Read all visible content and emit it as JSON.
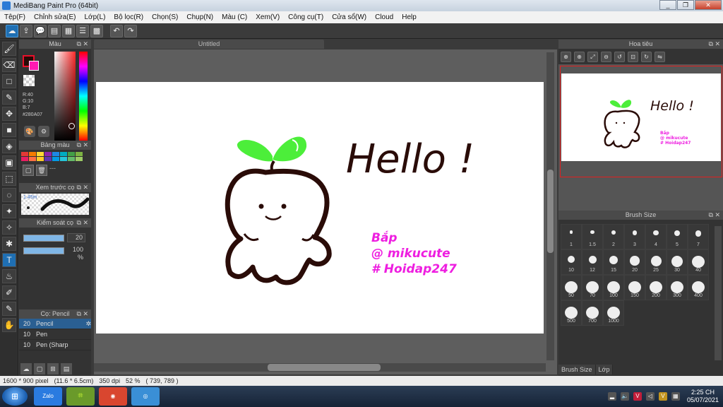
{
  "window": {
    "title": "MediBang Paint Pro (64bit)",
    "minimize": "_",
    "restore": "❐",
    "close": "✕"
  },
  "menu": [
    "Tệp(F)",
    "Chỉnh sửa(E)",
    "Lớp(L)",
    "Bộ lọc(R)",
    "Chọn(S)",
    "Chụp(N)",
    "Màu (C)",
    "Xem(V)",
    "Công cụ(T)",
    "Cửa sổ(W)",
    "Cloud",
    "Help"
  ],
  "toolbar": {
    "icons": [
      "cloud-icon",
      "share-icon",
      "chat-icon",
      "document-icon",
      "layers-icon",
      "list-icon",
      "grid-icon"
    ],
    "undo": "↶",
    "redo": "↷"
  },
  "tools": [
    "🖌",
    "⌫",
    "□",
    "✎",
    "✥",
    "■",
    "◈",
    "▣",
    "⬚",
    "◌",
    "✦",
    "✧",
    "✱",
    "T",
    "♨",
    "✐",
    "✎",
    "✋"
  ],
  "color_panel": {
    "title": "Màu",
    "r": "R:40",
    "g": "G:10",
    "b": "B:7",
    "hex": "#280A07",
    "fg": "#280A07",
    "bg": "#ff1ab2"
  },
  "palette_panel": {
    "title": "Bảng màu",
    "colors": [
      "#e53935",
      "#f57c00",
      "#fdd835",
      "#8e24aa",
      "#1e88e5",
      "#00acc1",
      "#43a047",
      "#7cb342",
      "#e91e63",
      "#ff7043",
      "#ffca28",
      "#5e35b1",
      "#039be5",
      "#26c6da",
      "#66bb6a",
      "#9ccc65"
    ],
    "dash": "---"
  },
  "preview_panel": {
    "title": "Xem trước cọ",
    "size": "1.45m"
  },
  "control_panel": {
    "title": "Kiểm soát cọ",
    "size_value": "20",
    "size_fraction": 1.0,
    "opacity_value": "100 %",
    "opacity_fraction": 1.0
  },
  "brush_panel": {
    "title": "Cọ: Pencil",
    "rows": [
      {
        "size": "20",
        "name": "Pencil",
        "selected": true
      },
      {
        "size": "10",
        "name": "Pen",
        "selected": false
      },
      {
        "size": "10",
        "name": "Pen (Sharp",
        "selected": false
      }
    ]
  },
  "document": {
    "tab": "Untitled"
  },
  "canvas_text": {
    "hello": "Hello !",
    "line1": "Bắp",
    "line2": "@ mikucute",
    "line3": "# Hoidap247"
  },
  "navigator": {
    "title": "Hoa tiêu",
    "icons": [
      "zoom-in-icon",
      "zoom-in-2-icon",
      "fit-icon",
      "zoom-out-icon",
      "rotate-left-icon",
      "actual-size-icon",
      "rotate-right-icon",
      "flip-icon"
    ]
  },
  "brush_size": {
    "title": "Brush Size",
    "sizes": [
      "1",
      "1.5",
      "2",
      "3",
      "4",
      "5",
      "7",
      "10",
      "12",
      "15",
      "20",
      "25",
      "30",
      "40",
      "50",
      "70",
      "100",
      "150",
      "200",
      "300",
      "400",
      "500",
      "700",
      "1000"
    ]
  },
  "right_tabs": [
    "Brush Size",
    "Lớp"
  ],
  "status": {
    "pixels": "1600 * 900 pixel",
    "cm": "(11.6 * 6.5cm)",
    "dpi": "350 dpi",
    "zoom": "52 %",
    "coords": "( 739, 789 )"
  },
  "taskbar": {
    "apps": [
      "Zalo",
      "🍀",
      "◉",
      "◎"
    ],
    "time": "2:25 CH",
    "date": "05/07/2021"
  }
}
